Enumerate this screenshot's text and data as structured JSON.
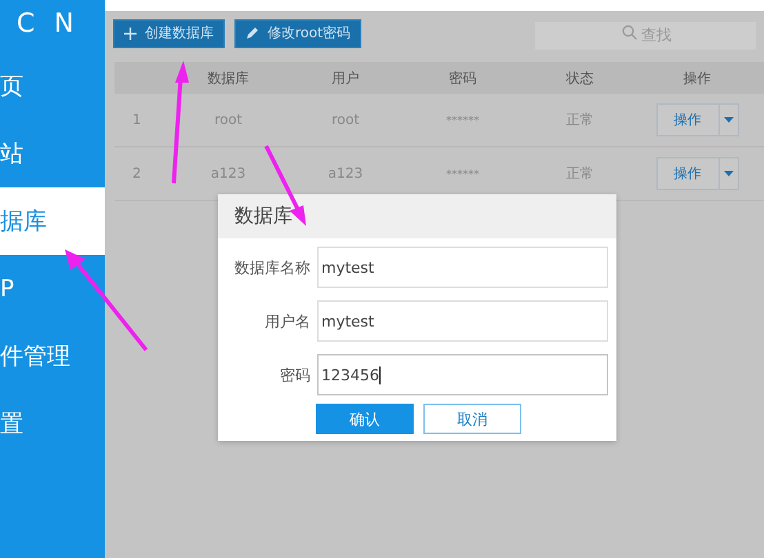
{
  "sidebar": {
    "logo": "C N",
    "items": [
      {
        "label": "页",
        "selected": false
      },
      {
        "label": "站",
        "selected": false
      },
      {
        "label": "据库",
        "selected": true
      },
      {
        "label": "P",
        "selected": false
      },
      {
        "label": "件管理",
        "selected": false
      },
      {
        "label": "置",
        "selected": false
      }
    ]
  },
  "toolbar": {
    "buttons": [
      {
        "label": "创建数据库",
        "kind": "create"
      },
      {
        "label": "修改root密码",
        "kind": "edit"
      }
    ],
    "search": {
      "placeholder": "查找"
    }
  },
  "table": {
    "columns": [
      "数据库",
      "用户",
      "密码",
      "状态",
      "操作"
    ],
    "rows": [
      {
        "index": "1",
        "database": "root",
        "user": "root",
        "password": "******",
        "status": "正常",
        "action": "操作"
      },
      {
        "index": "2",
        "database": "a123",
        "user": "a123",
        "password": "******",
        "status": "正常",
        "action": "操作"
      }
    ]
  },
  "dialog": {
    "title": "数据库",
    "fields": [
      {
        "label": "数据库名称",
        "value": "mytest",
        "focused": false
      },
      {
        "label": "用户名",
        "value": "mytest",
        "focused": false
      },
      {
        "label": "密码",
        "value": "123456",
        "focused": true
      }
    ],
    "buttons": [
      {
        "label": "确认",
        "kind": "primary"
      },
      {
        "label": "取消",
        "kind": "secondary"
      }
    ]
  }
}
